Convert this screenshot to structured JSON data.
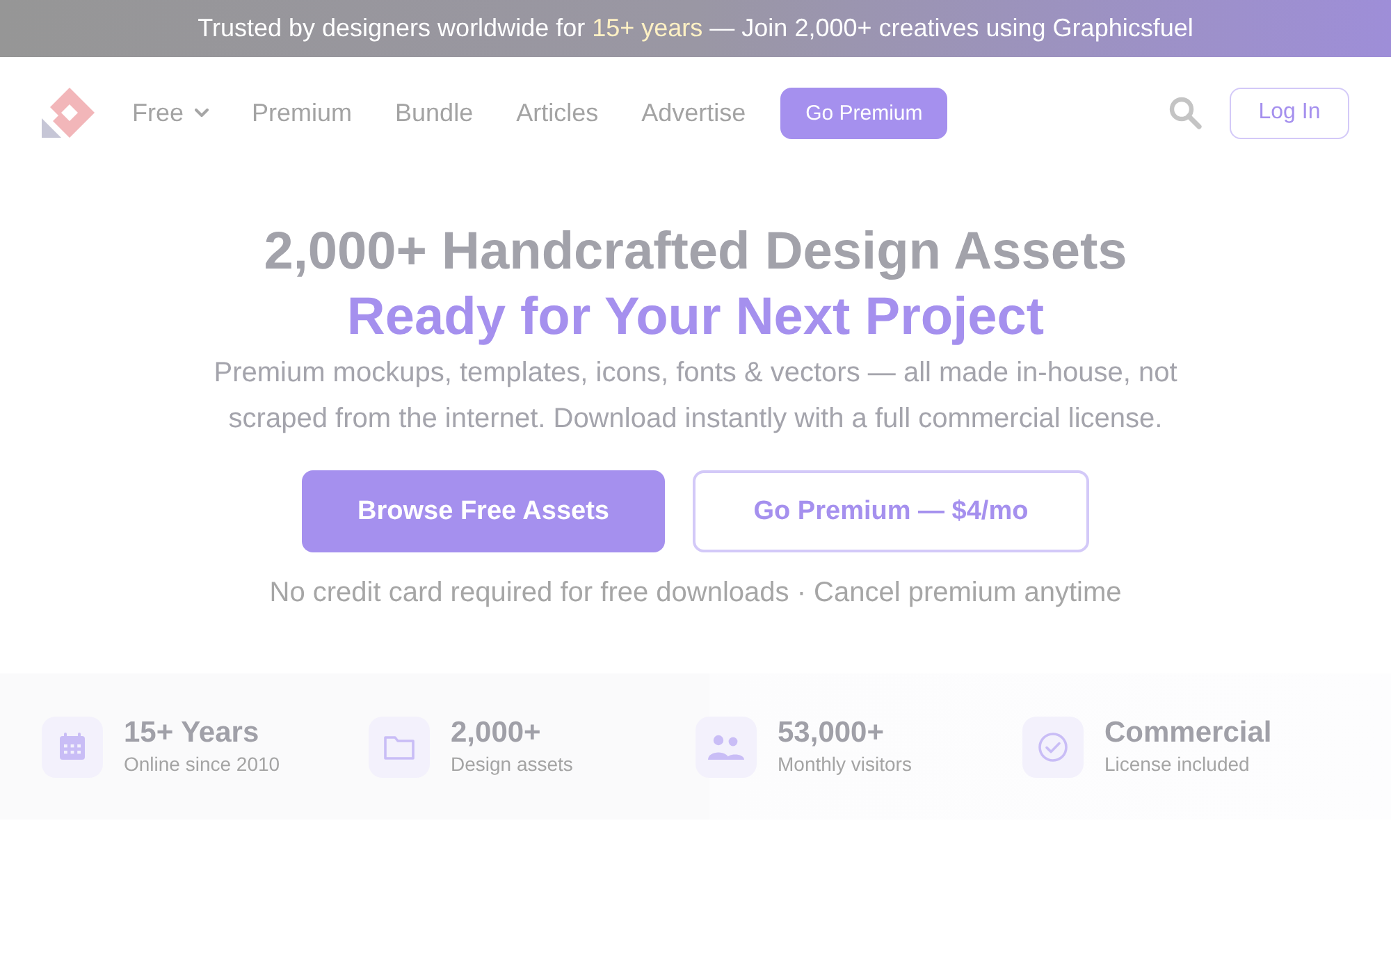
{
  "announcement_bar": {
    "text_before": "Trusted by designers worldwide for",
    "highlight": "15+ years",
    "text_after": "— Join 2,000+ creatives using Graphicsfuel"
  },
  "nav": {
    "items": [
      {
        "label": "Free",
        "kind": "dropdown"
      },
      {
        "label": "Premium",
        "kind": "link"
      },
      {
        "label": "Bundle",
        "kind": "link"
      },
      {
        "label": "Articles",
        "kind": "link"
      },
      {
        "label": "Advertise",
        "kind": "link"
      }
    ],
    "cta": "Go Premium",
    "login": "Log In"
  },
  "hero": {
    "title": "2,000+ Handcrafted Design Assets",
    "subtitle": "Ready for Your Next Project",
    "description": "Premium mockups, templates, icons, fonts & vectors — all made in-house, not scraped from the internet. Download instantly with a full commercial license.",
    "buttons": [
      {
        "label": "Browse Free Assets",
        "kind": "primary"
      },
      {
        "label": "Go Premium — $4/mo",
        "kind": "outline"
      }
    ],
    "note": "No credit card required for free downloads · Cancel premium anytime"
  },
  "stats": [
    {
      "value": "15+ Years",
      "label": "Online since 2010"
    },
    {
      "value": "2,000+",
      "label": "Design assets"
    },
    {
      "value": "53,000+",
      "label": "Monthly visitors"
    },
    {
      "value": "Commercial",
      "label": "License included"
    }
  ]
}
